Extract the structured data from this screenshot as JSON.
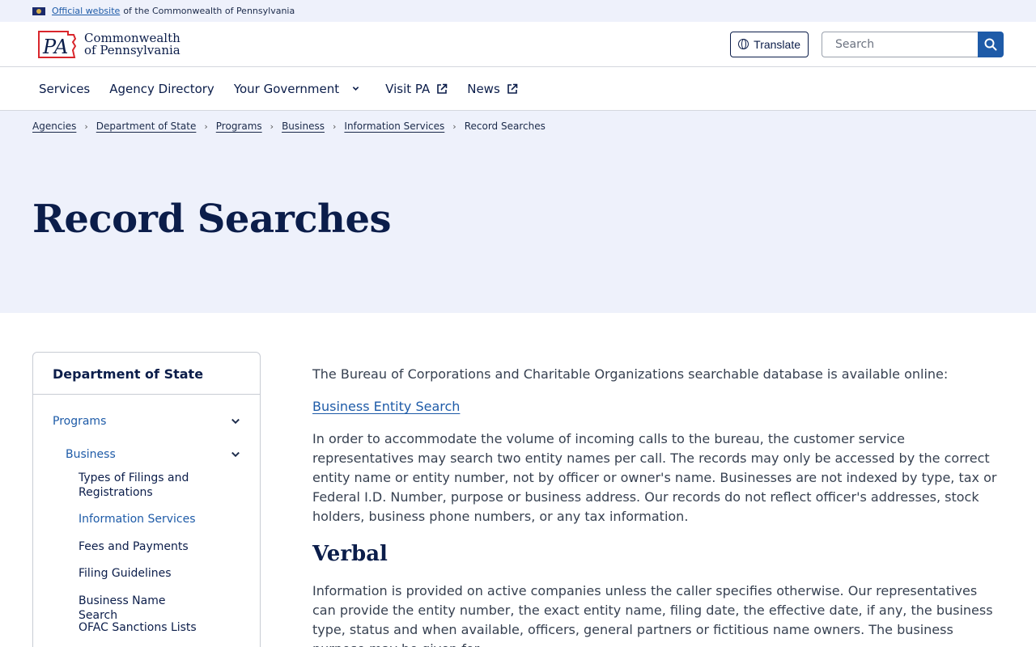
{
  "banner": {
    "official_link": "Official website",
    "rest": "of the Commonwealth of Pennsylvania"
  },
  "header": {
    "logo_mark": "PA",
    "logo_line1": "Commonwealth",
    "logo_line2": "of Pennsylvania",
    "translate_label": "Translate",
    "search_placeholder": "Search"
  },
  "nav": {
    "items": [
      "Services",
      "Agency Directory",
      "Your Government",
      "Visit PA",
      "News"
    ]
  },
  "breadcrumb": {
    "items": [
      "Agencies",
      "Department of State",
      "Programs",
      "Business",
      "Information Services"
    ],
    "current": "Record Searches"
  },
  "page": {
    "title": "Record Searches"
  },
  "sidenav": {
    "heading": "Department of State",
    "level1": "Programs",
    "level2": "Business",
    "level3": [
      "Types of Filings and Registrations",
      "Information Services",
      "Fees and Payments",
      "Filing Guidelines",
      "Business Name Search",
      "OFAC Sanctions Lists"
    ]
  },
  "main": {
    "intro": "The Bureau of Corporations and Charitable Organizations searchable database is available online:",
    "link": "Business Entity Search",
    "para1": "In order to accommodate the volume of incoming calls to the bureau, the customer service representatives may search two entity names per call. The records may only be accessed by the correct entity name or entity number, not by officer or owner's name. Businesses are not indexed by type, tax or Federal I.D. Number, purpose or business address. Our records do not reflect officer's addresses, stock holders, business phone numbers, or any tax information.",
    "heading_verbal": "Verbal",
    "para2": "Information is provided on active companies unless the caller specifies otherwise. Our representatives can provide the entity number, the exact entity name, filing date, the effective date, if any, the business type, status and when available, officers, general partners or fictitious name owners. The business purpose may be given for"
  },
  "colors": {
    "navy": "#0b1d4a",
    "link_blue": "#1e5ba8",
    "hero_bg": "#eef1fb",
    "logo_red": "#d9262c"
  }
}
